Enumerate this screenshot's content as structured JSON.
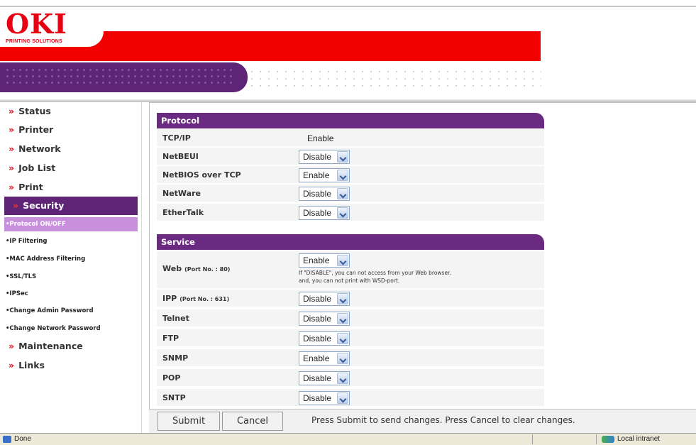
{
  "brand": {
    "logo": "OKI",
    "tagline": "PRINTING SOLUTIONS",
    "red": "#f20000",
    "purple": "#5e2576"
  },
  "sidebar": {
    "items": [
      {
        "label": "Status",
        "arrow": "»"
      },
      {
        "label": "Printer",
        "arrow": "»"
      },
      {
        "label": "Network",
        "arrow": "»"
      },
      {
        "label": "Job List",
        "arrow": "»"
      },
      {
        "label": "Print",
        "arrow": "»"
      },
      {
        "label": "Security",
        "arrow": "»"
      }
    ],
    "security_sub": [
      "•Protocol ON/OFF",
      "•IP Filtering",
      "•MAC Address Filtering",
      "•SSL/TLS",
      "•IPSec",
      "•Change Admin Password",
      "•Change Network Password"
    ],
    "bottom_items": [
      {
        "label": "Maintenance",
        "arrow": "»"
      },
      {
        "label": "Links",
        "arrow": "»"
      }
    ]
  },
  "protocol": {
    "title": "Protocol",
    "rows": [
      {
        "label": "TCP/IP",
        "value": "Enable"
      },
      {
        "label": "NetBEUI",
        "value": "Disable"
      },
      {
        "label": "NetBIOS over TCP",
        "value": "Enable"
      },
      {
        "label": "NetWare",
        "value": "Disable"
      },
      {
        "label": "EtherTalk",
        "value": "Disable"
      }
    ]
  },
  "service": {
    "title": "Service",
    "web": {
      "label": "Web",
      "port": "(Port No. : 80)",
      "value": "Enable",
      "note_line1": "If \"DISABLE\", you can not access from your Web browser.",
      "note_line2": "and, you can not print with WSD-port."
    },
    "ipp": {
      "label": "IPP",
      "port": "(Port No. : 631)",
      "value": "Disable"
    },
    "rows": [
      {
        "label": "Telnet",
        "value": "Disable"
      },
      {
        "label": "FTP",
        "value": "Disable"
      },
      {
        "label": "SNMP",
        "value": "Enable"
      },
      {
        "label": "POP",
        "value": "Disable"
      },
      {
        "label": "SNTP",
        "value": "Disable"
      }
    ]
  },
  "actions": {
    "submit": "Submit",
    "cancel": "Cancel",
    "hint": "Press Submit to send changes. Press Cancel to clear changes."
  },
  "status_bar": {
    "left": "Done",
    "zone": "Local intranet"
  }
}
